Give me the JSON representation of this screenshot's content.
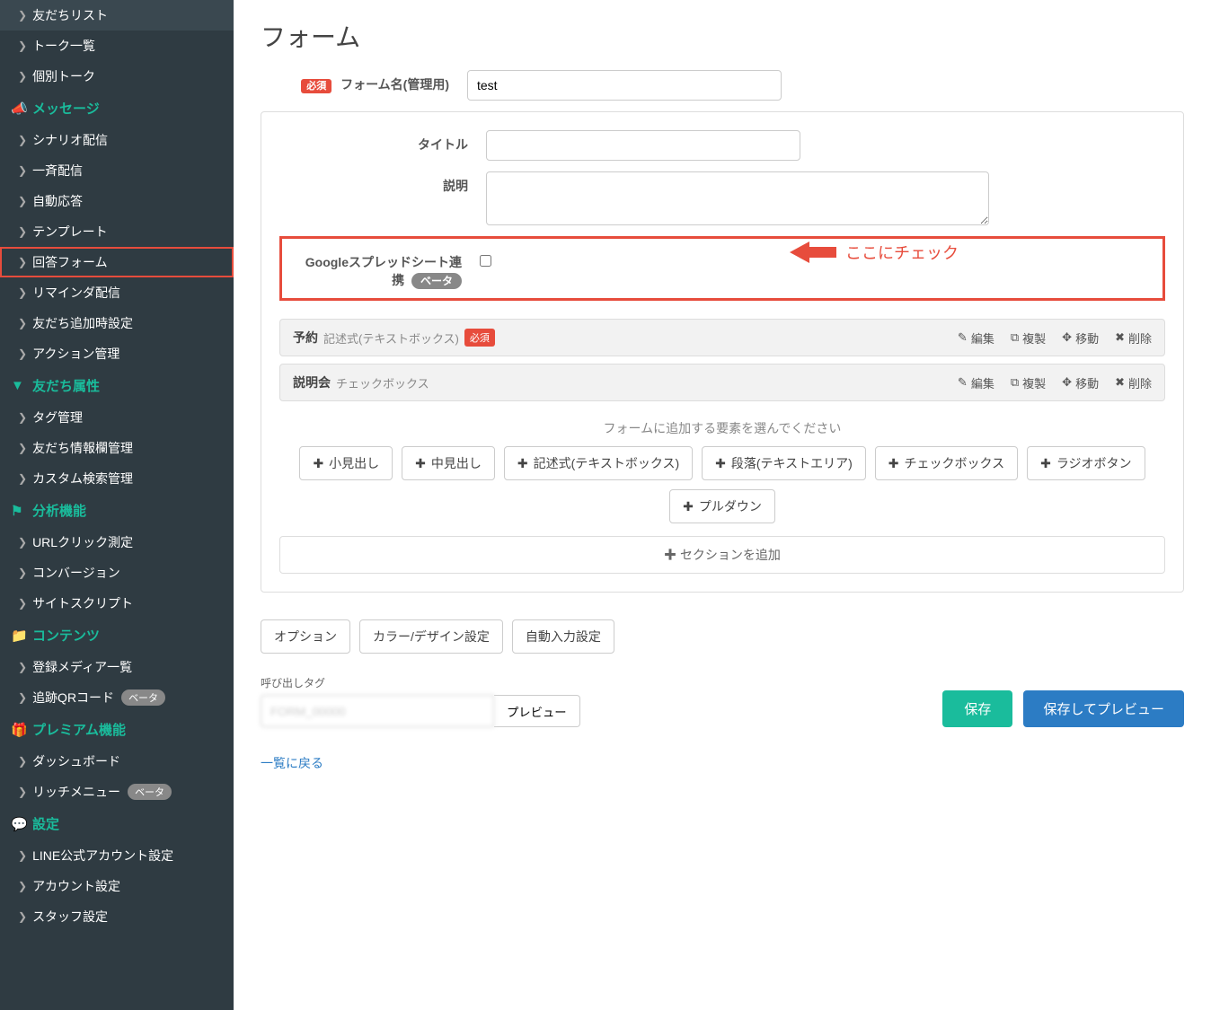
{
  "sidebar": {
    "items_top": [
      {
        "label": "友だちリスト"
      },
      {
        "label": "トーク一覧"
      },
      {
        "label": "個別トーク"
      }
    ],
    "section_message": "メッセージ",
    "items_message": [
      {
        "label": "シナリオ配信"
      },
      {
        "label": "一斉配信"
      },
      {
        "label": "自動応答"
      },
      {
        "label": "テンプレート"
      },
      {
        "label": "回答フォーム",
        "active": true
      },
      {
        "label": "リマインダ配信"
      },
      {
        "label": "友だち追加時設定"
      },
      {
        "label": "アクション管理"
      }
    ],
    "section_attr": "友だち属性",
    "items_attr": [
      {
        "label": "タグ管理"
      },
      {
        "label": "友だち情報欄管理"
      },
      {
        "label": "カスタム検索管理"
      }
    ],
    "section_analytics": "分析機能",
    "items_analytics": [
      {
        "label": "URLクリック測定"
      },
      {
        "label": "コンバージョン"
      },
      {
        "label": "サイトスクリプト"
      }
    ],
    "section_contents": "コンテンツ",
    "items_contents": [
      {
        "label": "登録メディア一覧"
      },
      {
        "label": "追跡QRコード",
        "beta": true
      }
    ],
    "section_premium": "プレミアム機能",
    "items_premium": [
      {
        "label": "ダッシュボード"
      },
      {
        "label": "リッチメニュー",
        "beta": true
      }
    ],
    "section_settings": "設定",
    "items_settings": [
      {
        "label": "LINE公式アカウント設定"
      },
      {
        "label": "アカウント設定"
      },
      {
        "label": "スタッフ設定"
      }
    ],
    "beta_text": "ベータ"
  },
  "page": {
    "title": "フォーム",
    "required_badge": "必須",
    "form_name_label": "フォーム名(管理用)",
    "form_name_value": "test",
    "title_label": "タイトル",
    "desc_label": "説明",
    "google_label_line1": "Googleスプレッドシート連",
    "google_label_line2": "携",
    "beta_pill": "ベータ",
    "annotation": "ここにチェック",
    "questions": [
      {
        "title": "予約",
        "type": "記述式(テキストボックス)",
        "required": true
      },
      {
        "title": "説明会",
        "type": "チェックボックス",
        "required": false
      }
    ],
    "actions": {
      "edit": "編集",
      "copy": "複製",
      "move": "移動",
      "delete": "削除"
    },
    "add_prompt": "フォームに追加する要素を選んでください",
    "element_buttons": [
      "小見出し",
      "中見出し",
      "記述式(テキストボックス)",
      "段落(テキストエリア)",
      "チェックボックス",
      "ラジオボタン",
      "プルダウン"
    ],
    "add_section": "セクションを追加",
    "option_buttons": [
      "オプション",
      "カラー/デザイン設定",
      "自動入力設定"
    ],
    "calltag_label": "呼び出しタグ",
    "calltag_value": "FORM_00000",
    "preview_btn": "プレビュー",
    "save_btn": "保存",
    "save_preview_btn": "保存してプレビュー",
    "back_link": "一覧に戻る"
  }
}
